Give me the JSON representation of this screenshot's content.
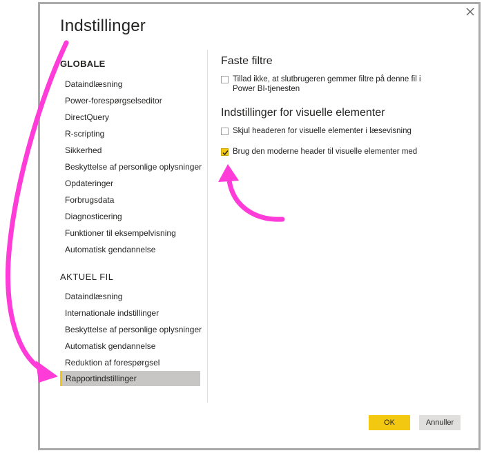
{
  "dialog": {
    "title": "Indstillinger"
  },
  "sidebar": {
    "global_header": "GLOBALE",
    "global_items": [
      "Dataindlæsning",
      "Power-forespørgselseditor",
      "DirectQuery",
      "R-scripting",
      "Sikkerhed",
      "Beskyttelse af personlige oplysninger",
      "Opdateringer",
      "Forbrugsdata",
      "Diagnosticering",
      "Funktioner til eksempelvisning",
      "Automatisk gendannelse"
    ],
    "current_header": "AKTUEL FIL",
    "current_items": [
      "Dataindlæsning",
      "Internationale indstillinger",
      "Beskyttelse af personlige oplysninger",
      "Automatisk gendannelse",
      "Reduktion af forespørgsel",
      "Rapportindstillinger"
    ],
    "selected_item": "Rapportindstillinger"
  },
  "main": {
    "persistent_filters": {
      "title": "Faste filtre",
      "option_line1": "Tillad ikke, at slutbrugeren gemmer filtre på denne fil i",
      "option_line2": "Power BI-tjenesten",
      "checked": false
    },
    "visual_settings": {
      "title": "Indstillinger for visuelle elementer",
      "hide_header_label": "Skjul headeren for visuelle elementer i læsevisning",
      "hide_header_checked": false,
      "modern_header_label": "Brug den moderne header til visuelle elementer med",
      "modern_header_checked": true
    }
  },
  "footer": {
    "ok_label": "OK",
    "cancel_label": "Annuller"
  },
  "colors": {
    "accent": "#f2c811",
    "selected_bg": "#c8c6c4",
    "annotation_arrow": "#ff3bd8",
    "dialog_border": "#a9a9a9"
  },
  "icons": {
    "close": "close-icon",
    "checkmark": "check-icon"
  }
}
